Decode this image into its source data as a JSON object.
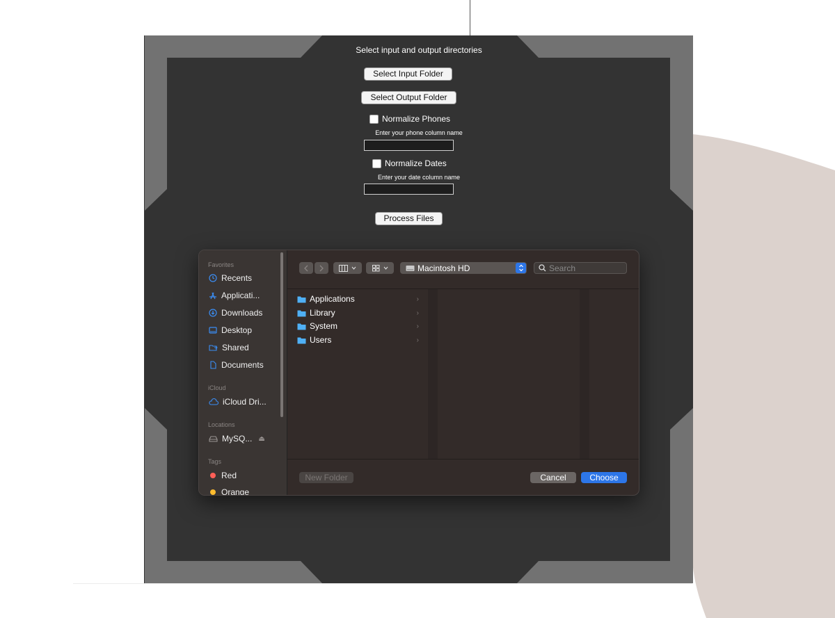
{
  "window": {
    "title": "Select input and output directories"
  },
  "form": {
    "select_input_label": "Select Input Folder",
    "select_output_label": "Select Output Folder",
    "normalize_phones_label": "Normalize Phones",
    "phone_hint": "Enter your phone column name",
    "phone_value": "",
    "normalize_dates_label": "Normalize Dates",
    "date_hint": "Enter your date column name",
    "date_value": "",
    "process_label": "Process Files"
  },
  "dialog": {
    "sidebar": {
      "favorites_heading": "Favorites",
      "favorites": [
        {
          "label": "Recents",
          "icon": "clock-icon"
        },
        {
          "label": "Applicati...",
          "icon": "app-store-icon"
        },
        {
          "label": "Downloads",
          "icon": "download-icon"
        },
        {
          "label": "Desktop",
          "icon": "desktop-icon"
        },
        {
          "label": "Shared",
          "icon": "shared-folder-icon"
        },
        {
          "label": "Documents",
          "icon": "document-icon"
        }
      ],
      "icloud_heading": "iCloud",
      "icloud": [
        {
          "label": "iCloud Dri...",
          "icon": "cloud-icon"
        }
      ],
      "locations_heading": "Locations",
      "locations": [
        {
          "label": "MySQ...",
          "icon": "drive-icon"
        }
      ],
      "tags_heading": "Tags",
      "tags": [
        {
          "label": "Red",
          "color": "#ff5f57"
        },
        {
          "label": "Orange",
          "color": "#febc2e"
        }
      ]
    },
    "toolbar": {
      "location": "Macintosh HD",
      "search_placeholder": "Search"
    },
    "files": [
      {
        "name": "Applications"
      },
      {
        "name": "Library"
      },
      {
        "name": "System"
      },
      {
        "name": "Users"
      }
    ],
    "footer": {
      "new_folder_label": "New Folder",
      "cancel_label": "Cancel",
      "choose_label": "Choose"
    },
    "colors": {
      "accent": "#2d76e8",
      "folder": "#4fb0f5"
    }
  }
}
